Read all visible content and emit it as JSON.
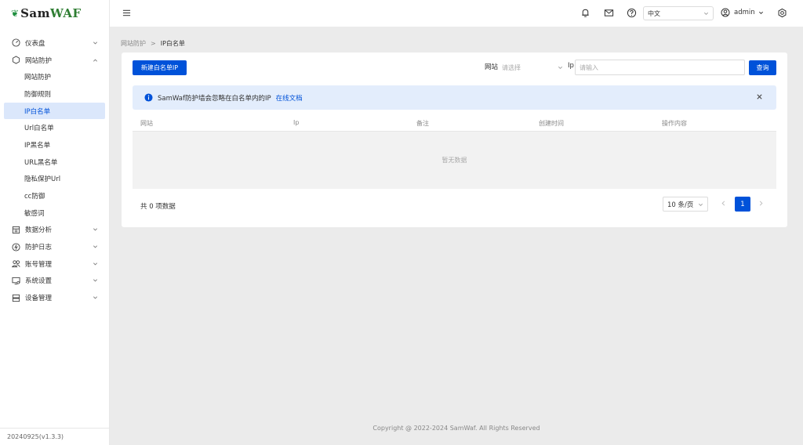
{
  "brand": {
    "name_a": "Sam",
    "name_b": "WAF",
    "logo_icon": "leaf-icon"
  },
  "sidebar": {
    "items": [
      {
        "label": "仪表盘",
        "icon": "dashboard-icon",
        "expanded": false
      },
      {
        "label": "网站防护",
        "icon": "shield-icon",
        "expanded": true,
        "children": [
          "网站防护",
          "防御规则",
          "IP白名单",
          "Url白名单",
          "IP黑名单",
          "URL黑名单",
          "隐私保护Url",
          "cc防御",
          "敏感词"
        ],
        "active_child": "IP白名单"
      },
      {
        "label": "数据分析",
        "icon": "chart-icon",
        "expanded": false
      },
      {
        "label": "防护日志",
        "icon": "log-icon",
        "expanded": false
      },
      {
        "label": "账号管理",
        "icon": "users-icon",
        "expanded": false
      },
      {
        "label": "系统设置",
        "icon": "monitor-icon",
        "expanded": false
      },
      {
        "label": "设备管理",
        "icon": "server-icon",
        "expanded": false
      }
    ],
    "version": "20240925(v1.3.3)"
  },
  "header": {
    "language": "中文",
    "username": "admin",
    "icons": [
      "menu-icon",
      "bell-icon",
      "mail-icon",
      "help-icon",
      "user-icon",
      "settings-icon"
    ]
  },
  "breadcrumb": {
    "parent": "网站防护",
    "separator": ">",
    "current": "IP白名单"
  },
  "toolbar": {
    "add_label": "新建白名单IP",
    "site_label": "网站",
    "site_placeholder": "请选择",
    "ip_label": "Ip",
    "ip_placeholder": "请输入",
    "query_label": "查询"
  },
  "alert": {
    "text": "SamWaf防护墙会忽略在白名单内的IP",
    "link": "在线文档"
  },
  "table": {
    "columns": [
      "网站",
      "Ip",
      "备注",
      "创建时间",
      "操作内容"
    ],
    "empty_text": "暂无数据"
  },
  "pagination": {
    "total_text": "共 0 项数据",
    "page_size": "10 条/页",
    "current_page": "1"
  },
  "footer": {
    "copyright": "Copyright @ 2022-2024 SamWaf. All Rights Reserved"
  },
  "colors": {
    "primary": "#0052d9",
    "active_bg": "#dbe7fb",
    "alert_bg": "#e3edfc",
    "page_bg": "#ebebeb"
  }
}
